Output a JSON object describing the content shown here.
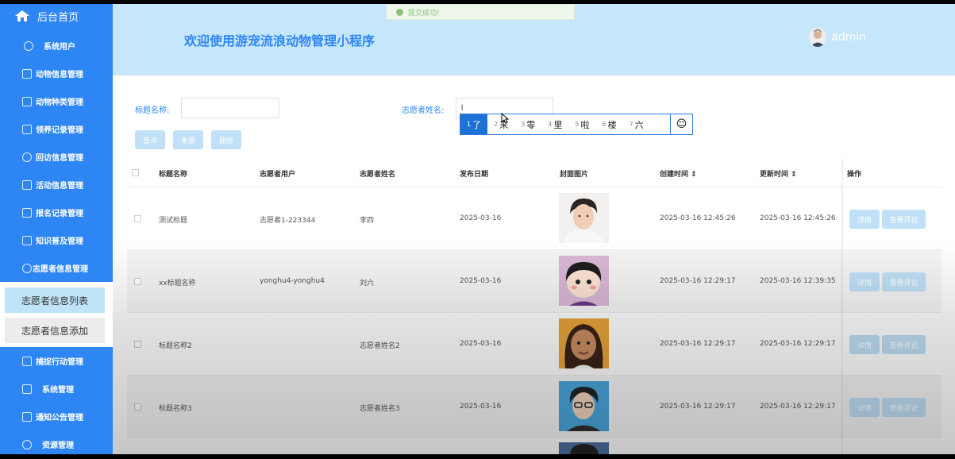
{
  "toast": {
    "text": "提交成功!"
  },
  "sidebar": {
    "home_label": "后台首页",
    "items": [
      {
        "label": "系统用户",
        "icon": "cloud-icon"
      },
      {
        "label": "动物信息管理",
        "icon": "edit-icon"
      },
      {
        "label": "动物种类管理",
        "icon": "chart-icon"
      },
      {
        "label": "领养记录管理",
        "icon": "edit-icon"
      },
      {
        "label": "回访信息管理",
        "icon": "chat-icon"
      },
      {
        "label": "活动信息管理",
        "icon": "edit-icon"
      },
      {
        "label": "报名记录管理",
        "icon": "badge-icon"
      },
      {
        "label": "知识普及管理",
        "icon": "edit-icon"
      },
      {
        "label": "志愿者信息管理",
        "icon": "cloud-icon"
      }
    ],
    "sub_items": [
      "志愿者信息列表",
      "志愿者信息添加"
    ],
    "items_after": [
      {
        "label": "捕捉行动管理",
        "icon": "edit-icon"
      },
      {
        "label": "系统管理",
        "icon": "close-box-icon"
      },
      {
        "label": "通知公告管理",
        "icon": "chart-icon"
      },
      {
        "label": "资源管理",
        "icon": "cloud-icon"
      }
    ]
  },
  "header": {
    "title": "欢迎使用游宠流浪动物管理小程序",
    "username": "admin"
  },
  "search": {
    "title_label": "标题名称:",
    "title_value": "",
    "name_label": "志愿者姓名:",
    "name_value": "l",
    "buttons": [
      "查询",
      "重置",
      "删除"
    ]
  },
  "ime": {
    "candidates": [
      {
        "num": "1",
        "text": "了"
      },
      {
        "num": "2",
        "text": "来"
      },
      {
        "num": "3",
        "text": "零"
      },
      {
        "num": "4",
        "text": "里"
      },
      {
        "num": "5",
        "text": "啦"
      },
      {
        "num": "6",
        "text": "楼"
      },
      {
        "num": "7",
        "text": "六"
      }
    ],
    "emoji": "☺"
  },
  "table": {
    "headers": [
      "标题名称",
      "志愿者用户",
      "志愿者姓名",
      "发布日期",
      "封面图片",
      "创建时间 ⇕",
      "更新时间 ⇕",
      "操作"
    ],
    "rows": [
      {
        "title": "测试标题",
        "user": "志愿者1-223344",
        "name": "李四",
        "date": "2025-03-16",
        "created": "2025-03-16 12:45:26",
        "updated": "2025-03-16 12:45:26"
      },
      {
        "title": "xx标题名称",
        "user": "yonghu4-yonghu4",
        "name": "刘六",
        "date": "2025-03-16",
        "created": "2025-03-16 12:29:17",
        "updated": "2025-03-16 12:39:35"
      },
      {
        "title": "标题名称2",
        "user": "",
        "name": "志愿者姓名2",
        "date": "2025-03-16",
        "created": "2025-03-16 12:29:17",
        "updated": "2025-03-16 12:29:17"
      },
      {
        "title": "标题名称3",
        "user": "",
        "name": "志愿者姓名3",
        "date": "2025-03-16",
        "created": "2025-03-16 12:29:17",
        "updated": "2025-03-16 12:29:17"
      }
    ],
    "action_detail": "详情",
    "action_comment": "查看评论"
  }
}
